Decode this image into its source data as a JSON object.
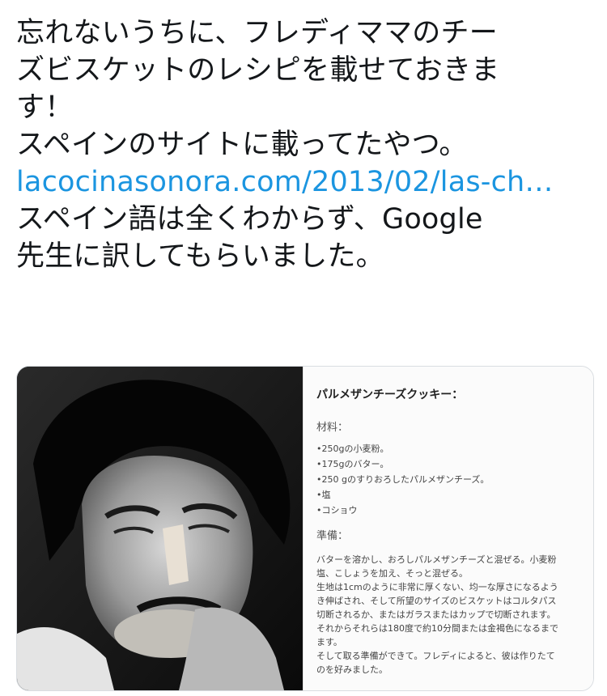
{
  "tweet": {
    "lines": [
      "忘れないうちに、フレディママのチー",
      "ズビスケットのレシピを載せておきま",
      "す！",
      "スペインのサイトに載ってたやつ。"
    ],
    "link": "lacocinasonora.com/2013/02/las-ch…",
    "lines_after": [
      "スペイン語は全くわからず、Google",
      "先生に訳してもらいました。"
    ]
  },
  "recipe": {
    "title": "パルメザンチーズクッキー：",
    "ingredients_heading": "材料：",
    "ingredients": [
      "•250gの小麦粉。",
      "•175gのバター。",
      "•250 gのすりおろしたパルメザンチーズ。",
      "•塩",
      "•コショウ"
    ],
    "steps_heading": "準備：",
    "steps": [
      "バターを溶かし、おろしパルメザンチーズと混ぜる。小麦粉",
      "塩、こしょうを加え、そっと混ぜる。",
      "生地は1cmのように非常に厚くない、均一な厚さになるよう",
      "き伸ばされ、そして所望のサイズのビスケットはコルタパス",
      "切断されるか、またはガラスまたはカップで切断されます。",
      "それからそれらは180度で約10分間または金褐色になるまで",
      "ます。",
      "そして取る準備ができて。フレディによると、彼は作りたて",
      "のを好みました。"
    ]
  }
}
